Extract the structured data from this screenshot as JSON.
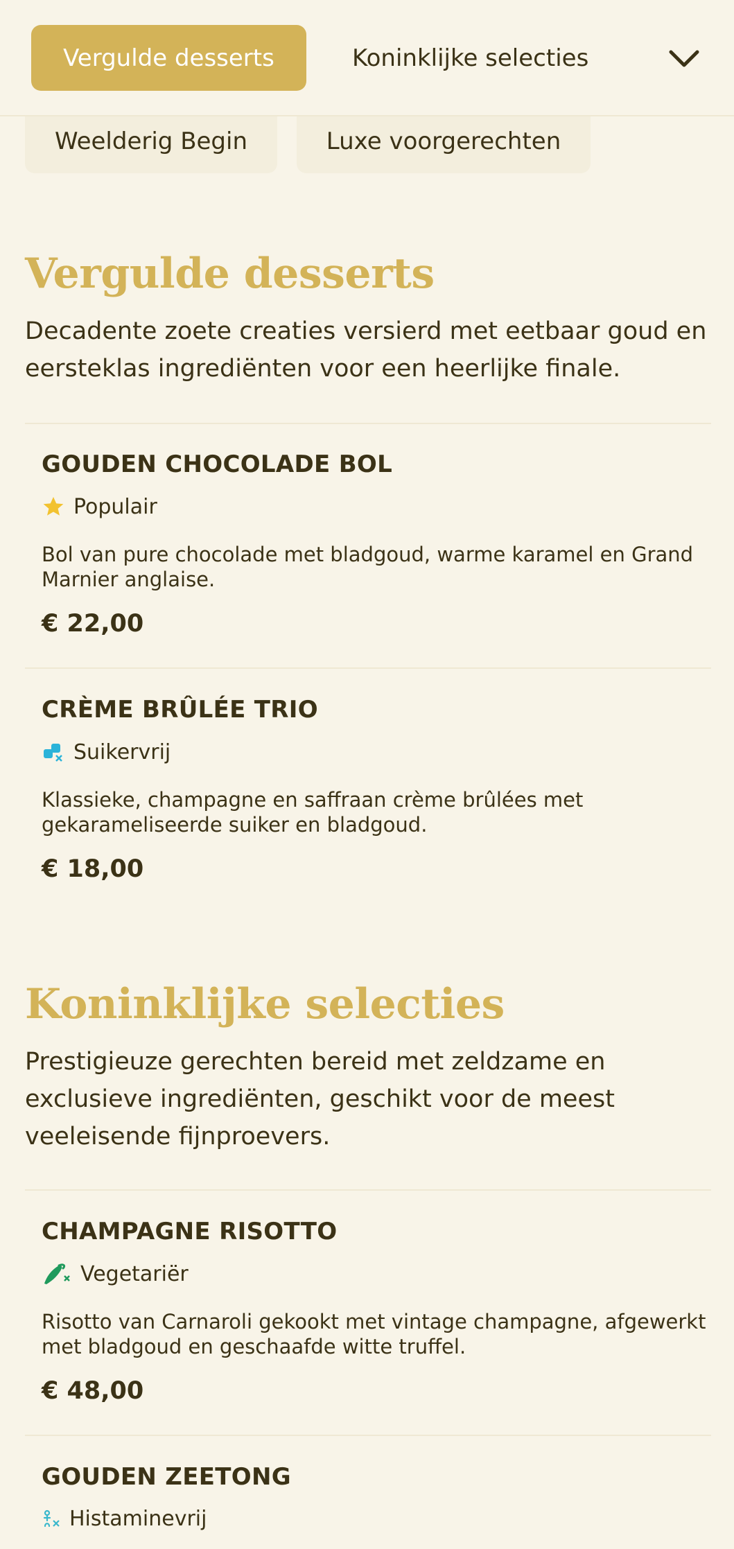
{
  "categories": {
    "active": "Vergulde desserts",
    "next": "Koninklijke selecties",
    "row2": [
      "Weelderig Begin",
      "Luxe voorgerechten"
    ]
  },
  "sections": [
    {
      "title": "Vergulde desserts",
      "description": "Decadente zoete creaties versierd met eetbaar goud en eersteklas ingrediënten voor een heerlijke finale.",
      "items": [
        {
          "name": "GOUDEN CHOCOLADE BOL",
          "badge": "Populair",
          "badge_icon": "star-icon",
          "description": "Bol van pure chocolade met bladgoud, warme karamel en Grand Marnier anglaise.",
          "price": "€ 22,00"
        },
        {
          "name": "CRÈME BRÛLÉE TRIO",
          "badge": "Suikervrij",
          "badge_icon": "sugar-free-icon",
          "description": "Klassieke, champagne en saffraan crème brûlées met gekarameliseerde suiker en bladgoud.",
          "price": "€ 18,00"
        }
      ]
    },
    {
      "title": "Koninklijke selecties",
      "description": "Prestigieuze gerechten bereid met zeldzame en exclusieve ingrediënten, geschikt voor de meest veeleisende fijnproevers.",
      "items": [
        {
          "name": "CHAMPAGNE RISOTTO",
          "badge": "Vegetariër",
          "badge_icon": "vegetarian-icon",
          "description": "Risotto van Carnaroli gekookt met vintage champagne, afgewerkt met bladgoud en geschaafde witte truffel.",
          "price": "€ 48,00"
        },
        {
          "name": "GOUDEN ZEETONG",
          "badge": "Histaminevrij",
          "badge_icon": "histamine-free-icon"
        }
      ]
    }
  ],
  "colors": {
    "gold": "#d3b358",
    "background": "#f8f4e8",
    "text": "#3b3216",
    "star": "#f2c230",
    "sugar_free": "#2bb3d9",
    "vegetarian": "#1f9a5c",
    "histamine_free": "#39b7cc"
  }
}
